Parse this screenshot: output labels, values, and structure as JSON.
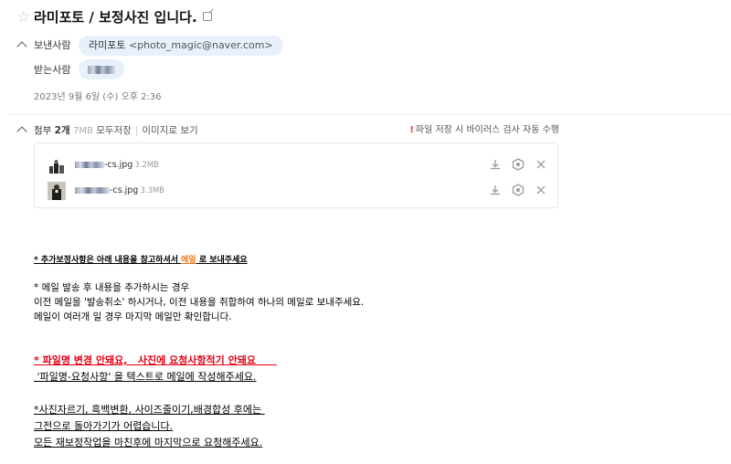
{
  "header": {
    "subject": "라미포토 / 보정사진 입니다.",
    "star_icon": "star-icon",
    "open_new_icon": "external-link-icon"
  },
  "sender": {
    "label": "보낸사람",
    "name": "라미포토",
    "email": "<photo_magic@naver.com>"
  },
  "recipient": {
    "label": "받는사람"
  },
  "date": "2023년 9월 6일 (수) 오후 2:36",
  "attachments": {
    "label": "첨부",
    "count": "2개",
    "total_size": "7MB",
    "save_all": "모두저장",
    "view_as_image": "이미지로 보기",
    "warning": "파일 저장 시 바이러스 검사 자동 수행",
    "warning_mark": "!",
    "files": [
      {
        "name_suffix": "-cs.jpg",
        "size": "3.2MB"
      },
      {
        "name_suffix": "-cs.jpg",
        "size": "3.3MB"
      }
    ],
    "action_icons": [
      "download-icon",
      "shield-scan-icon",
      "close-icon"
    ]
  },
  "message": {
    "notice_prefix": "* 추가보정사항은 아래 내용을 참고하셔서 ",
    "notice_highlight": "메일",
    "notice_suffix": " 로 보내주세요",
    "p1_line1": "* 메일 발송 후 내용을 추가하시는 경우",
    "p1_line2": "이전 메일을 '발송취소' 하시거나,   이전 내용을 취합하여 하나의 메일로 보내주세요.",
    "p1_line3": "메일이 여러개 일 경우 마지막 메일만 확인합니다.",
    "red_line": "* 파일명 변경 안돼요,   사진에 요청사항적기 안돼요      ",
    "p2_line": " '파일명-요청사항' 을 텍스트로 메일에 작성해주세요.",
    "p3_line1": "*사진자르기, 흑백변환, 사이즈줄이기,배경합성 후에는 ",
    "p3_line2": "그전으로 돌아가기가 어렵습니다.",
    "p3_line3": "모든 재보정작업을 마친후에 마지막으로 요청해주세요."
  },
  "colors": {
    "chip_bg": "#e8f0fb",
    "warning_red": "#e53935",
    "body_red": "#e60012",
    "highlight_orange": "#ec7a1c"
  }
}
